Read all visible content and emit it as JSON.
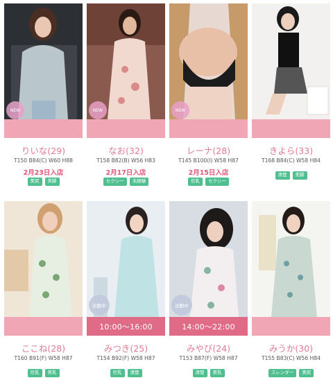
{
  "cards": [
    {
      "name": "りいな(29)",
      "stats": "T150 B84(C) W60 H88",
      "entry": "2月23日入店",
      "tags": [
        "美尻",
        "美脚"
      ],
      "badge": "NEW",
      "time": ""
    },
    {
      "name": "なお(32)",
      "stats": "T158 B82(B) W56 H83",
      "entry": "2月17日入店",
      "tags": [
        "セクシー",
        "未経験"
      ],
      "badge": "NEW",
      "time": ""
    },
    {
      "name": "レーナ(28)",
      "stats": "T145 B100(I) W58 H87",
      "entry": "2月15日入店",
      "tags": [
        "巨乳",
        "セクシー"
      ],
      "badge": "NEW",
      "time": ""
    },
    {
      "name": "きよら(33)",
      "stats": "T168 B84(C) W58 H84",
      "entry": "",
      "tags": [
        "清楚",
        "美脚"
      ],
      "badge": "",
      "time": ""
    },
    {
      "name": "ここね(28)",
      "stats": "T160 B91(F) W58 H87",
      "entry": "",
      "tags": [
        "巨乳",
        "美乳"
      ],
      "badge": "",
      "time": ""
    },
    {
      "name": "みつき(25)",
      "stats": "T154 B92(F) W58 H87",
      "entry": "",
      "tags": [
        "巨乳",
        "清楚"
      ],
      "badge": "出勤中",
      "time": "10:00〜16:00"
    },
    {
      "name": "みやび(24)",
      "stats": "T153 B87(F) W58 H87",
      "entry": "",
      "tags": [
        "清楚",
        "美乳"
      ],
      "badge": "出勤中",
      "time": "14:00〜22:00"
    },
    {
      "name": "みうか(30)",
      "stats": "T155 B83(C) W56 H84",
      "entry": "",
      "tags": [
        "スレンダー",
        "美尻"
      ],
      "badge": "",
      "time": ""
    }
  ],
  "colors": {
    "accent_pink": "#f1a6b6",
    "time_pink": "#e06b86",
    "name_pink": "#e17b94",
    "tag_green": "#4fbf8f"
  }
}
